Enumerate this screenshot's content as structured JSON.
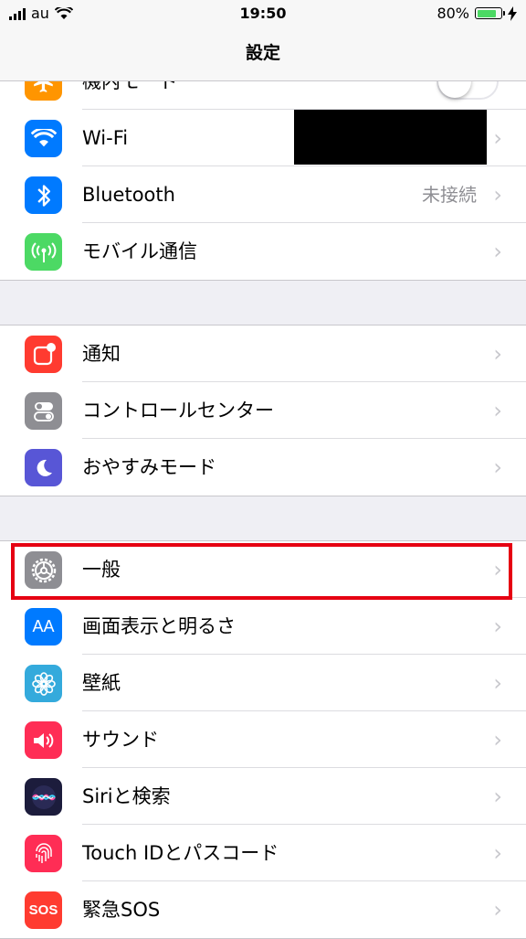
{
  "status_bar": {
    "carrier": "au",
    "time": "19:50",
    "battery": "80%"
  },
  "nav": {
    "title": "設定"
  },
  "groups": [
    [
      {
        "label": "機内モード",
        "icon": "airplane-icon",
        "color": "#ff9500",
        "control": "toggle"
      },
      {
        "label": "Wi-Fi",
        "icon": "wifi-icon",
        "color": "#007aff"
      },
      {
        "label": "Bluetooth",
        "icon": "bluetooth-icon",
        "color": "#007aff",
        "value": "未接続"
      },
      {
        "label": "モバイル通信",
        "icon": "cellular-icon",
        "color": "#4cd964"
      }
    ],
    [
      {
        "label": "通知",
        "icon": "notifications-icon",
        "color": "#ff3b30"
      },
      {
        "label": "コントロールセンター",
        "icon": "control-center-icon",
        "color": "#8e8e93"
      },
      {
        "label": "おやすみモード",
        "icon": "moon-icon",
        "color": "#5856d6"
      }
    ],
    [
      {
        "label": "一般",
        "icon": "gear-icon",
        "color": "#8e8e93"
      },
      {
        "label": "画面表示と明るさ",
        "icon": "text-size-icon",
        "color": "#007aff",
        "glyph": "AA"
      },
      {
        "label": "壁紙",
        "icon": "wallpaper-flower-icon",
        "color": "#34aadc"
      },
      {
        "label": "サウンド",
        "icon": "speaker-icon",
        "color": "#ff2d55"
      },
      {
        "label": "Siriと検索",
        "icon": "siri-icon",
        "color": "#1c1c3c"
      },
      {
        "label": "Touch IDとパスコード",
        "icon": "fingerprint-icon",
        "color": "#ff2d55"
      },
      {
        "label": "緊急SOS",
        "icon": "sos-icon",
        "color": "#ff3b30",
        "glyph": "SOS"
      }
    ]
  ]
}
